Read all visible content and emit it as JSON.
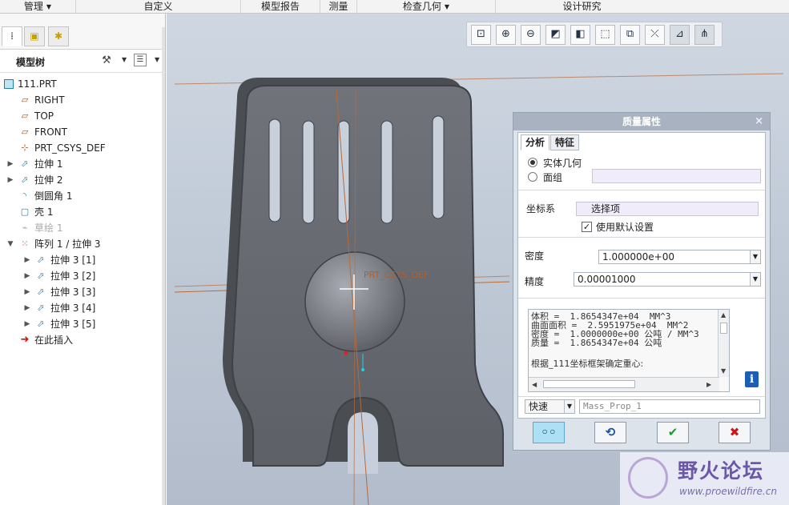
{
  "ribbon": {
    "tabs": [
      {
        "label": "管理",
        "dropdown": true
      },
      {
        "label": "自定义",
        "dropdown": false
      },
      {
        "label": "模型报告",
        "dropdown": false
      },
      {
        "label": "测量",
        "dropdown": false
      },
      {
        "label": "检查几何",
        "dropdown": true
      },
      {
        "label": "设计研究",
        "dropdown": false
      }
    ]
  },
  "model_tree": {
    "title": "模型树",
    "nodes": [
      {
        "label": "111.PRT",
        "icon": "part-icon"
      },
      {
        "label": "RIGHT",
        "icon": "datum-plane-icon"
      },
      {
        "label": "TOP",
        "icon": "datum-plane-icon"
      },
      {
        "label": "FRONT",
        "icon": "datum-plane-icon"
      },
      {
        "label": "PRT_CSYS_DEF",
        "icon": "csys-icon"
      },
      {
        "label": "拉伸 1",
        "icon": "extrude-icon"
      },
      {
        "label": "拉伸 2",
        "icon": "extrude-icon"
      },
      {
        "label": "倒圆角 1",
        "icon": "round-icon"
      },
      {
        "label": "壳 1",
        "icon": "shell-icon"
      },
      {
        "label": "草绘 1",
        "icon": "sketch-icon"
      },
      {
        "label": "阵列 1 / 拉伸 3",
        "icon": "pattern-icon"
      },
      {
        "label": "拉伸 3 [1]",
        "icon": "extrude-icon"
      },
      {
        "label": "拉伸 3 [2]",
        "icon": "extrude-icon"
      },
      {
        "label": "拉伸 3 [3]",
        "icon": "extrude-icon"
      },
      {
        "label": "拉伸 3 [4]",
        "icon": "extrude-icon"
      },
      {
        "label": "拉伸 3 [5]",
        "icon": "extrude-icon"
      },
      {
        "label": "在此插入",
        "icon": "insert-arrow-icon"
      }
    ]
  },
  "viewport": {
    "csys_label": "PRT_CSYS_DEF"
  },
  "dialog": {
    "title": "质量属性",
    "tabs": [
      "分析",
      "特征"
    ],
    "radio_solid": "实体几何",
    "radio_quilt": "面组",
    "csys_label": "坐标系",
    "csys_select": "选择项",
    "use_default": "使用默认设置",
    "density_label": "密度",
    "density_value": "1.000000e+00",
    "accuracy_label": "精度",
    "accuracy_value": "0.00001000",
    "results": [
      "体积 =  1.8654347e+04  MM^3",
      "曲面面积 =  2.5951975e+04  MM^2",
      "密度 =  1.0000000e+00 公吨 / MM^3",
      "质量 =  1.8654347e+04 公吨",
      "根据_111坐标框架确定重心:"
    ],
    "mode_value": "快速",
    "name_value": "Mass_Prop_1"
  },
  "watermark": {
    "title": "野火论坛",
    "url": "www.proewildfire.cn"
  }
}
